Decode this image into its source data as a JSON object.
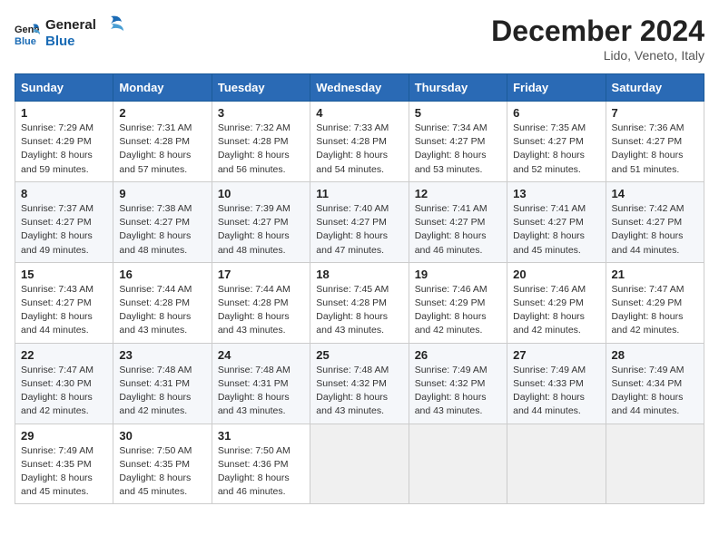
{
  "header": {
    "logo_line1": "General",
    "logo_line2": "Blue",
    "month_title": "December 2024",
    "location": "Lido, Veneto, Italy"
  },
  "weekdays": [
    "Sunday",
    "Monday",
    "Tuesday",
    "Wednesday",
    "Thursday",
    "Friday",
    "Saturday"
  ],
  "weeks": [
    [
      {
        "day": "1",
        "info": "Sunrise: 7:29 AM\nSunset: 4:29 PM\nDaylight: 8 hours\nand 59 minutes."
      },
      {
        "day": "2",
        "info": "Sunrise: 7:31 AM\nSunset: 4:28 PM\nDaylight: 8 hours\nand 57 minutes."
      },
      {
        "day": "3",
        "info": "Sunrise: 7:32 AM\nSunset: 4:28 PM\nDaylight: 8 hours\nand 56 minutes."
      },
      {
        "day": "4",
        "info": "Sunrise: 7:33 AM\nSunset: 4:28 PM\nDaylight: 8 hours\nand 54 minutes."
      },
      {
        "day": "5",
        "info": "Sunrise: 7:34 AM\nSunset: 4:27 PM\nDaylight: 8 hours\nand 53 minutes."
      },
      {
        "day": "6",
        "info": "Sunrise: 7:35 AM\nSunset: 4:27 PM\nDaylight: 8 hours\nand 52 minutes."
      },
      {
        "day": "7",
        "info": "Sunrise: 7:36 AM\nSunset: 4:27 PM\nDaylight: 8 hours\nand 51 minutes."
      }
    ],
    [
      {
        "day": "8",
        "info": "Sunrise: 7:37 AM\nSunset: 4:27 PM\nDaylight: 8 hours\nand 49 minutes."
      },
      {
        "day": "9",
        "info": "Sunrise: 7:38 AM\nSunset: 4:27 PM\nDaylight: 8 hours\nand 48 minutes."
      },
      {
        "day": "10",
        "info": "Sunrise: 7:39 AM\nSunset: 4:27 PM\nDaylight: 8 hours\nand 48 minutes."
      },
      {
        "day": "11",
        "info": "Sunrise: 7:40 AM\nSunset: 4:27 PM\nDaylight: 8 hours\nand 47 minutes."
      },
      {
        "day": "12",
        "info": "Sunrise: 7:41 AM\nSunset: 4:27 PM\nDaylight: 8 hours\nand 46 minutes."
      },
      {
        "day": "13",
        "info": "Sunrise: 7:41 AM\nSunset: 4:27 PM\nDaylight: 8 hours\nand 45 minutes."
      },
      {
        "day": "14",
        "info": "Sunrise: 7:42 AM\nSunset: 4:27 PM\nDaylight: 8 hours\nand 44 minutes."
      }
    ],
    [
      {
        "day": "15",
        "info": "Sunrise: 7:43 AM\nSunset: 4:27 PM\nDaylight: 8 hours\nand 44 minutes."
      },
      {
        "day": "16",
        "info": "Sunrise: 7:44 AM\nSunset: 4:28 PM\nDaylight: 8 hours\nand 43 minutes."
      },
      {
        "day": "17",
        "info": "Sunrise: 7:44 AM\nSunset: 4:28 PM\nDaylight: 8 hours\nand 43 minutes."
      },
      {
        "day": "18",
        "info": "Sunrise: 7:45 AM\nSunset: 4:28 PM\nDaylight: 8 hours\nand 43 minutes."
      },
      {
        "day": "19",
        "info": "Sunrise: 7:46 AM\nSunset: 4:29 PM\nDaylight: 8 hours\nand 42 minutes."
      },
      {
        "day": "20",
        "info": "Sunrise: 7:46 AM\nSunset: 4:29 PM\nDaylight: 8 hours\nand 42 minutes."
      },
      {
        "day": "21",
        "info": "Sunrise: 7:47 AM\nSunset: 4:29 PM\nDaylight: 8 hours\nand 42 minutes."
      }
    ],
    [
      {
        "day": "22",
        "info": "Sunrise: 7:47 AM\nSunset: 4:30 PM\nDaylight: 8 hours\nand 42 minutes."
      },
      {
        "day": "23",
        "info": "Sunrise: 7:48 AM\nSunset: 4:31 PM\nDaylight: 8 hours\nand 42 minutes."
      },
      {
        "day": "24",
        "info": "Sunrise: 7:48 AM\nSunset: 4:31 PM\nDaylight: 8 hours\nand 43 minutes."
      },
      {
        "day": "25",
        "info": "Sunrise: 7:48 AM\nSunset: 4:32 PM\nDaylight: 8 hours\nand 43 minutes."
      },
      {
        "day": "26",
        "info": "Sunrise: 7:49 AM\nSunset: 4:32 PM\nDaylight: 8 hours\nand 43 minutes."
      },
      {
        "day": "27",
        "info": "Sunrise: 7:49 AM\nSunset: 4:33 PM\nDaylight: 8 hours\nand 44 minutes."
      },
      {
        "day": "28",
        "info": "Sunrise: 7:49 AM\nSunset: 4:34 PM\nDaylight: 8 hours\nand 44 minutes."
      }
    ],
    [
      {
        "day": "29",
        "info": "Sunrise: 7:49 AM\nSunset: 4:35 PM\nDaylight: 8 hours\nand 45 minutes."
      },
      {
        "day": "30",
        "info": "Sunrise: 7:50 AM\nSunset: 4:35 PM\nDaylight: 8 hours\nand 45 minutes."
      },
      {
        "day": "31",
        "info": "Sunrise: 7:50 AM\nSunset: 4:36 PM\nDaylight: 8 hours\nand 46 minutes."
      },
      null,
      null,
      null,
      null
    ]
  ]
}
